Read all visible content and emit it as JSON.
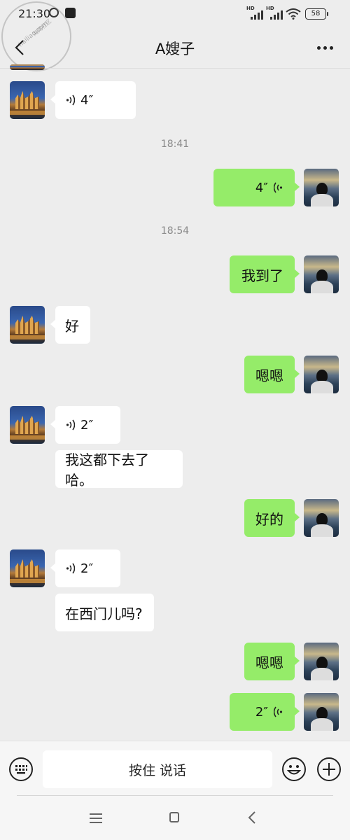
{
  "status_bar": {
    "time": "21:30",
    "signal_badges": [
      "HD",
      "HD"
    ],
    "battery_level": "58"
  },
  "watermark": {
    "line1": "海南社区",
    "line2": "hailiao.com"
  },
  "header": {
    "title": "A嫂子"
  },
  "messages": {
    "m1": {
      "side": "left",
      "type": "voice",
      "duration": "4″"
    },
    "t1": "18:41",
    "m2": {
      "side": "right",
      "type": "voice",
      "duration": "4″"
    },
    "t2": "18:54",
    "m3": {
      "side": "right",
      "type": "text",
      "text": "我到了"
    },
    "m4": {
      "side": "left",
      "type": "text",
      "text": "好"
    },
    "m5": {
      "side": "right",
      "type": "text",
      "text": "嗯嗯"
    },
    "m6": {
      "side": "left",
      "type": "voice",
      "duration": "2″"
    },
    "m7": {
      "side": "left",
      "type": "text",
      "text": "我这都下去了哈。"
    },
    "m8": {
      "side": "right",
      "type": "text",
      "text": "好的"
    },
    "m9": {
      "side": "left",
      "type": "voice",
      "duration": "2″"
    },
    "m10": {
      "side": "left",
      "type": "text",
      "text": "在西门儿吗?"
    },
    "m11": {
      "side": "right",
      "type": "text",
      "text": "嗯嗯"
    },
    "m12": {
      "side": "right",
      "type": "voice",
      "duration": "2″"
    }
  },
  "input_bar": {
    "hold_to_talk_label": "按住 说话"
  },
  "colors": {
    "background": "#ededed",
    "sent_bubble": "#95ec69",
    "received_bubble": "#ffffff",
    "timestamp_text": "#8a8a8a"
  },
  "icons": [
    "back-arrow",
    "more-dots",
    "voice-wave",
    "keyboard",
    "emoji",
    "plus",
    "menu",
    "home",
    "back-triangle"
  ]
}
